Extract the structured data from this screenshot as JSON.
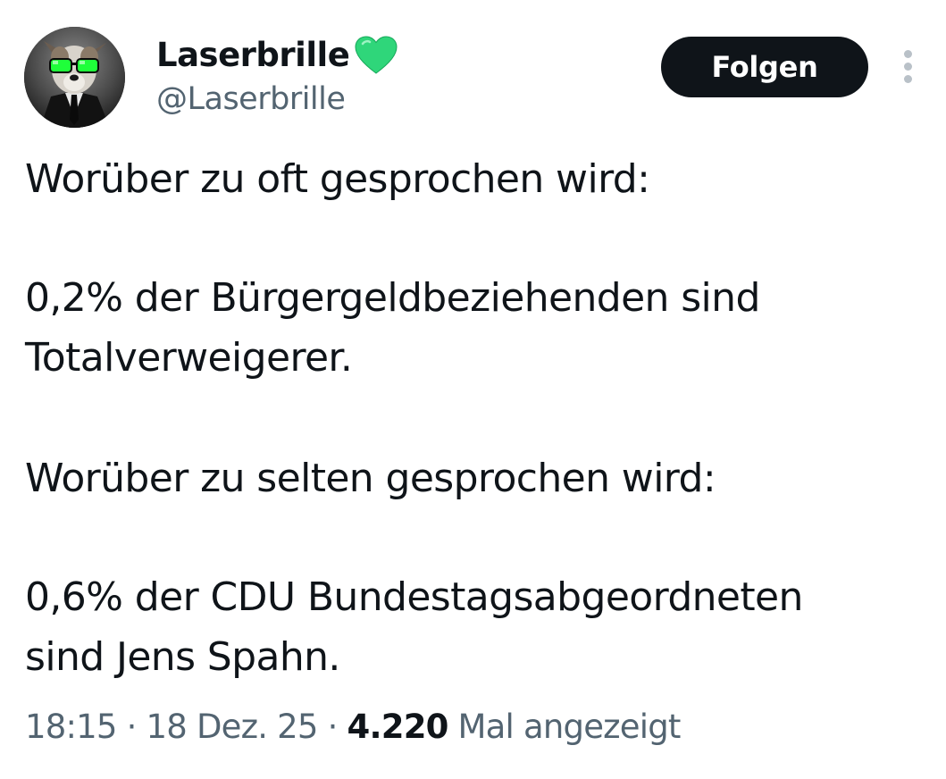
{
  "author": {
    "display_name": "Laserbrille",
    "handle": "@Laserbrille",
    "badge_icon": "green-heart-icon",
    "badge_color": "#2fd67a"
  },
  "actions": {
    "follow_label": "Folgen",
    "more_icon": "more-vertical-icon"
  },
  "tweet": {
    "lines": [
      "Worüber zu oft gesprochen wird:",
      "0,2% der Bürgergeldbeziehenden sind",
      "Totalverweigerer.",
      "Worüber zu selten gesprochen wird:",
      "0,6% der CDU Bundestagsabgeordneten",
      "sind Jens Spahn."
    ]
  },
  "meta": {
    "time": "18:15",
    "separator": " · ",
    "date": "18 Dez. 25",
    "views_count": "4.220",
    "views_label": " Mal angezeigt"
  },
  "colors": {
    "text_primary": "#0f1419",
    "text_secondary": "#536471",
    "button_bg": "#0f1419"
  }
}
